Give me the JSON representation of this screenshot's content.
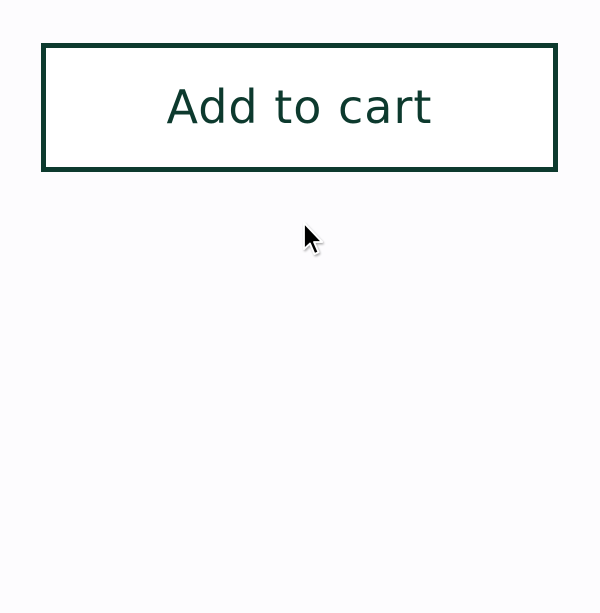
{
  "button": {
    "label": "Add to cart",
    "border_color": "#0d3a2e",
    "text_color": "#0d3a2e"
  },
  "page": {
    "background": "#fdfcfe"
  },
  "cursor": {
    "icon": "arrow-pointer-icon"
  }
}
